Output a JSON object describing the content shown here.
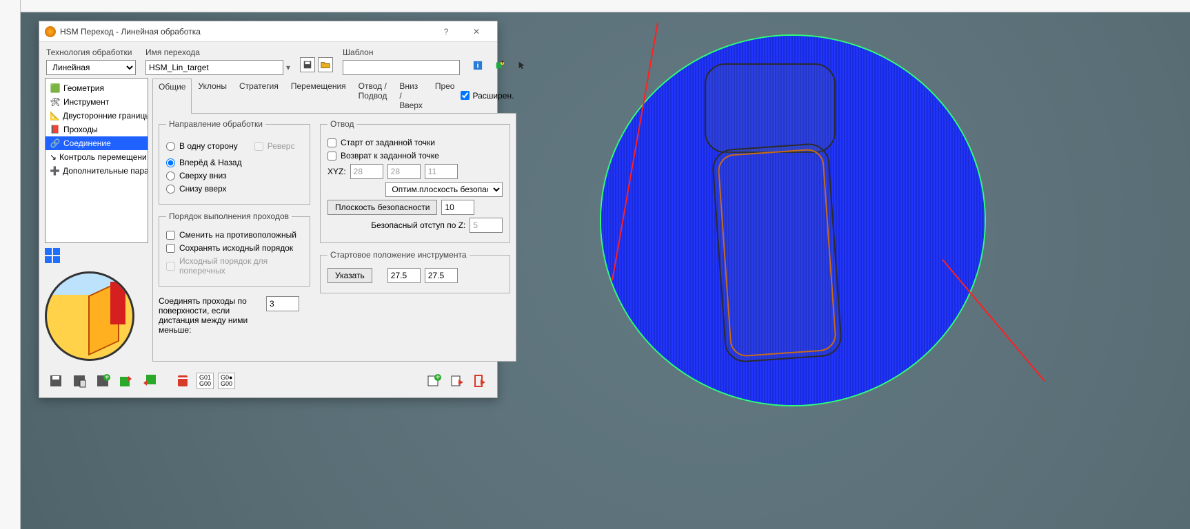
{
  "window": {
    "title": "HSM Переход - Линейная обработка",
    "help": "?",
    "close": "✕"
  },
  "toprow": {
    "tech_label": "Технология обработки",
    "tech_value": "Линейная",
    "pass_label": "Имя перехода",
    "pass_value": "HSM_Lin_target",
    "template_label": "Шаблон",
    "template_value": ""
  },
  "tree": {
    "items": [
      {
        "label": "Геометрия"
      },
      {
        "label": "Инструмент"
      },
      {
        "label": "Двусторонние границы"
      },
      {
        "label": "Проходы"
      },
      {
        "label": "Соединение"
      },
      {
        "label": "Контроль перемещени"
      },
      {
        "label": "Дополнительные пара"
      }
    ],
    "selected_index": 4
  },
  "tabs": {
    "items": [
      "Общие",
      "Уклоны",
      "Стратегия",
      "Перемещения",
      "Отвод / Подвод",
      "Вниз / Вверх",
      "Прео"
    ],
    "active_index": 0,
    "ext_label": "Расширен."
  },
  "direction": {
    "legend": "Направление обработки",
    "options": [
      "В одну сторону",
      "Вперёд & Назад",
      "Сверху вниз",
      "Снизу вверх"
    ],
    "selected_index": 1,
    "reverse_label": "Реверс"
  },
  "order": {
    "legend": "Порядок выполнения проходов",
    "swap_label": "Сменить на противоположный",
    "keep_label": "Сохранять исходный порядок",
    "orig_cross_label": "Исходный порядок для поперечных"
  },
  "join": {
    "label": "Соединять проходы по поверхности, если дистанция между ними меньше:",
    "value": "3"
  },
  "retract": {
    "legend": "Отвод",
    "start_label": "Старт от заданной точки",
    "return_label": "Возврат к заданной точке",
    "xyz_label": "XYZ:",
    "xyz": [
      "28",
      "28",
      "11"
    ],
    "plane_mode": "Оптим.плоскость безопасности",
    "plane_button": "Плоскость безопасности",
    "plane_value": "10",
    "safez_label": "Безопасный отступ по Z:",
    "safez_value": "5"
  },
  "startpos": {
    "legend": "Стартовое положение инструмента",
    "button": "Указать",
    "v1": "27.5",
    "v2": "27.5"
  },
  "footer": {
    "g1": "G01\nG00",
    "g0": "G0●\nG00"
  }
}
